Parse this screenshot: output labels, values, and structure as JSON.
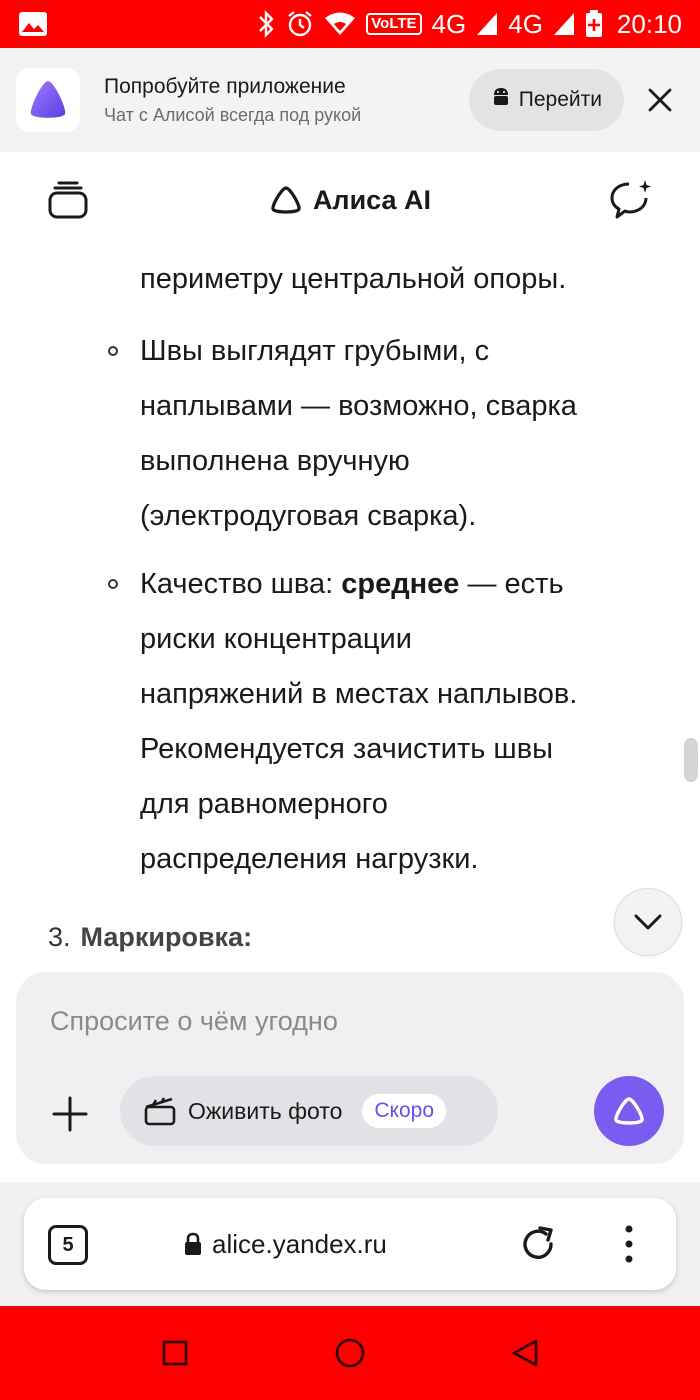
{
  "status_bar": {
    "icons": [
      "gallery-icon",
      "bluetooth-icon",
      "alarm-icon",
      "wifi-icon"
    ],
    "volte": "VoLTE",
    "net1": "4G",
    "net2": "4G",
    "time": "20:10",
    "color": "#ff0000"
  },
  "banner": {
    "title": "Попробуйте приложение",
    "subtitle": "Чат с Алисой всегда под рукой",
    "open_label": "Перейти"
  },
  "header": {
    "title": "Алиса AI"
  },
  "message": {
    "line_top": "периметру центральной опоры.",
    "bullet1_lines": [
      "Швы выглядят грубыми, с",
      "наплывами — возможно, сварка",
      "выполнена вручную",
      "(электродуговая сварка)."
    ],
    "bullet2_prefix": "Качество шва: ",
    "bullet2_bold": "среднее",
    "bullet2_suffix": " — есть",
    "bullet2_lines": [
      "риски концентрации",
      "напряжений в местах наплывов.",
      "Рекомендуется зачистить швы",
      "для равномерного",
      "распределения нагрузки."
    ],
    "numbered_index": "3.",
    "numbered_title": "Маркировка:"
  },
  "composer": {
    "placeholder": "Спросите о чём угодно",
    "chip_label": "Оживить фото",
    "soon_label": "Скоро",
    "accent": "#7b5cf0"
  },
  "browser": {
    "tabs_count": "5",
    "url": "alice.yandex.ru"
  }
}
